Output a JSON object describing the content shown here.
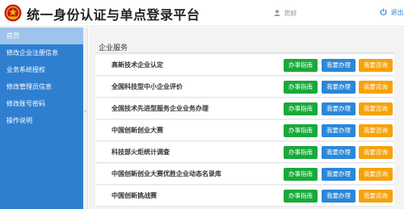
{
  "header": {
    "title": "统一身份认证与单点登录平台",
    "user_label": "您好",
    "logout_label": "退出",
    "logo_icon": "national-emblem-icon",
    "user_icon": "user-icon",
    "logout_icon": "power-icon"
  },
  "sidebar": {
    "items": [
      {
        "label": "首页",
        "active": true
      },
      {
        "label": "修改企业注册信息"
      },
      {
        "label": "业务系统授权"
      },
      {
        "label": "修改管理员信息"
      },
      {
        "label": "修改账号密码"
      },
      {
        "label": "操作说明"
      }
    ],
    "collapse_arrow": "‹"
  },
  "main": {
    "section_title": "企业服务",
    "services": [
      {
        "name": "高新技术企业认定",
        "guide": "办事指南",
        "apply": "我要办理",
        "consult": "我要咨询"
      },
      {
        "name": "全国科技型中小企业评价",
        "guide": "办事指南",
        "apply": "我要办理",
        "consult": "我要咨询"
      },
      {
        "name": "全国技术先进型服务企业业务办理",
        "guide": "办事指南",
        "apply": "我要办理",
        "consult": "我要咨询"
      },
      {
        "name": "中国创新创业大赛",
        "guide": "办事指南",
        "apply": "我要办理",
        "consult": "我要咨询"
      },
      {
        "name": "科技部火炬统计调查",
        "guide": "办事指南",
        "apply": "我要办理",
        "consult": "我要咨询"
      },
      {
        "name": "中国创新创业大赛优胜企业动态名录库",
        "guide": "办事指南",
        "apply": "我要办理",
        "consult": "我要咨询"
      },
      {
        "name": "中国创新挑战赛",
        "guide": "办事指南",
        "apply": "我要办理",
        "consult": "我要咨询"
      }
    ]
  },
  "colors": {
    "sidebar": "#2f7fd0",
    "sidebar_active": "#9ec4ec",
    "guide_button": "#19a93a",
    "apply_button": "#2b87d8",
    "consult_button": "#f5a20d",
    "logout_text": "#2b87d8"
  }
}
